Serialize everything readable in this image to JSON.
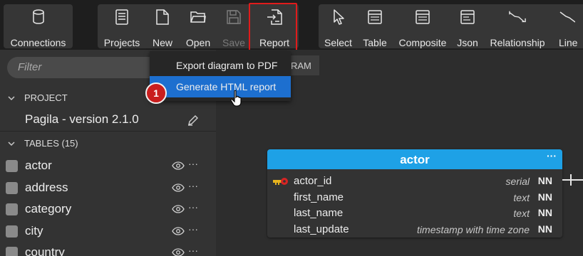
{
  "toolbar": {
    "connections": {
      "label": "Connections",
      "icon": "database-icon"
    },
    "projects": {
      "label": "Projects",
      "icon": "projects-icon"
    },
    "new": {
      "label": "New",
      "icon": "new-file-icon"
    },
    "open": {
      "label": "Open",
      "icon": "folder-open-icon"
    },
    "save": {
      "label": "Save",
      "icon": "save-icon",
      "disabled": true
    },
    "report": {
      "label": "Report",
      "icon": "report-icon",
      "highlight_color": "#e01b1b"
    },
    "select": {
      "label": "Select",
      "icon": "pointer-icon"
    },
    "table": {
      "label": "Table",
      "icon": "table-icon"
    },
    "composite": {
      "label": "Composite",
      "icon": "composite-icon"
    },
    "json": {
      "label": "Json",
      "icon": "json-icon"
    },
    "relationship": {
      "label": "Relationship",
      "icon": "relationship-icon"
    },
    "line": {
      "label": "Line",
      "icon": "line-icon"
    }
  },
  "report_menu": {
    "items": [
      {
        "label": "Export diagram to PDF"
      },
      {
        "label": "Generate HTML report",
        "active": true
      }
    ],
    "active_color": "#1d6fcf"
  },
  "step_badge": {
    "number": "1",
    "color": "#c91e1e"
  },
  "sidebar": {
    "filter_placeholder": "Filter",
    "project_header": "PROJECT",
    "project_name": "Pagila - version 2.1.0",
    "tables_header": "TABLES (15)",
    "tables": [
      {
        "name": "actor"
      },
      {
        "name": "address"
      },
      {
        "name": "category"
      },
      {
        "name": "city"
      },
      {
        "name": "country"
      }
    ],
    "row_more": "···"
  },
  "canvas": {
    "tab_label": "RAM",
    "entity": {
      "name": "actor",
      "header_color": "#1ea1e6",
      "more": "···",
      "columns": [
        {
          "name": "actor_id",
          "type": "serial",
          "nn": "NN",
          "pk": true
        },
        {
          "name": "first_name",
          "type": "text",
          "nn": "NN"
        },
        {
          "name": "last_name",
          "type": "text",
          "nn": "NN"
        },
        {
          "name": "last_update",
          "type": "timestamp with time zone",
          "nn": "NN"
        }
      ]
    }
  }
}
